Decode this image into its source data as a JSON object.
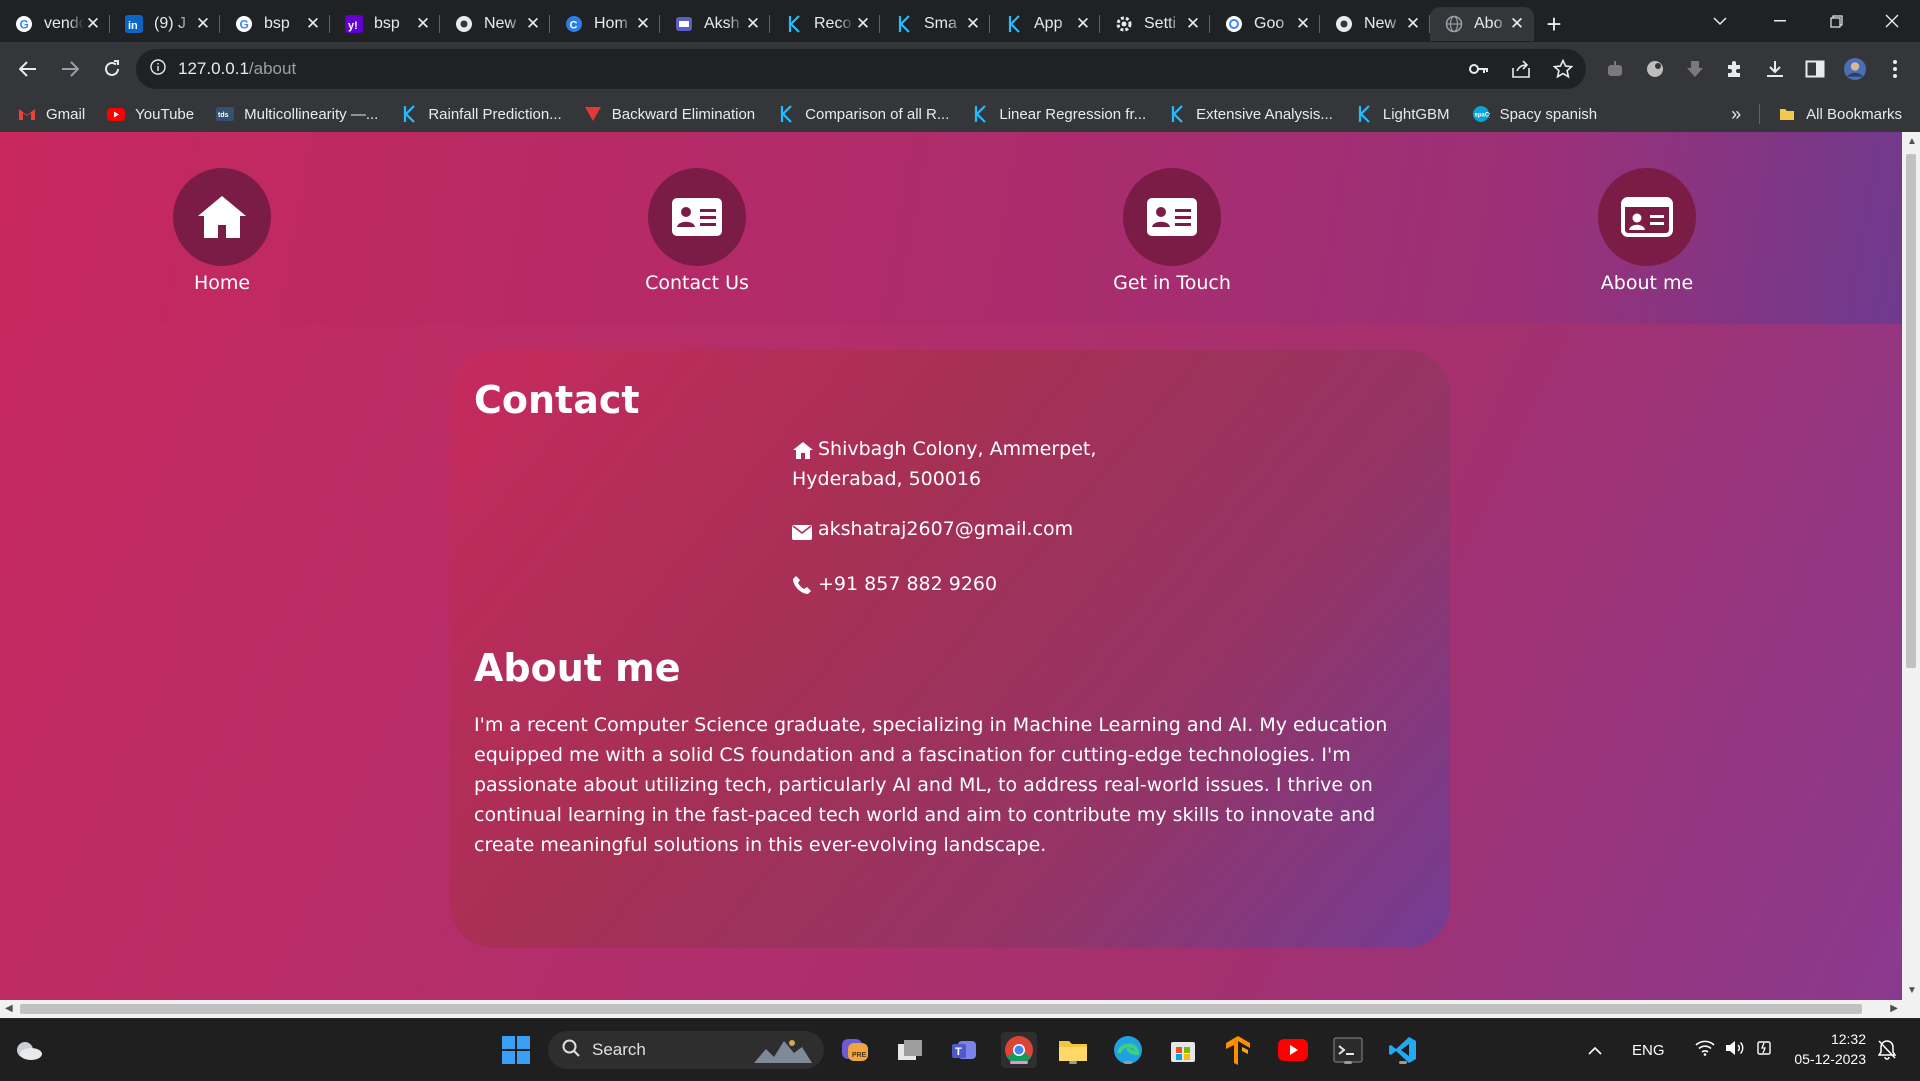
{
  "browser": {
    "tabs": [
      {
        "title": "vendor",
        "icon": "google-icon",
        "color": "#ffffff"
      },
      {
        "title": "(9) J",
        "icon": "linkedin-icon",
        "color": "#0a66c2"
      },
      {
        "title": "bsp",
        "icon": "google-icon",
        "color": "#ffffff"
      },
      {
        "title": "bsp",
        "icon": "yahoo-icon",
        "color": "#6001d2"
      },
      {
        "title": "New",
        "icon": "chrome-icon",
        "color": "#ffffff"
      },
      {
        "title": "Hom",
        "icon": "c-logo-icon",
        "color": "#2b7de9"
      },
      {
        "title": "Aksh",
        "icon": "app-icon",
        "color": "#5b5fc7"
      },
      {
        "title": "Reco",
        "icon": "kaggle-icon",
        "color": "#20beff"
      },
      {
        "title": "Sma",
        "icon": "kaggle-icon",
        "color": "#20beff"
      },
      {
        "title": "App",
        "icon": "kaggle-icon",
        "color": "#20beff"
      },
      {
        "title": "Setti",
        "icon": "gear-icon",
        "color": "#e8eaed"
      },
      {
        "title": "Goo",
        "icon": "google-lens-icon",
        "color": "#ffffff"
      },
      {
        "title": "New",
        "icon": "chrome-icon",
        "color": "#ffffff"
      },
      {
        "title": "Abo",
        "icon": "globe-icon",
        "color": "#9aa0a6",
        "active": true
      }
    ],
    "url_host": "127.0.0.1",
    "url_path": "/about",
    "bookmarks": [
      {
        "label": "Gmail",
        "icon": "gmail-icon"
      },
      {
        "label": "YouTube",
        "icon": "youtube-icon"
      },
      {
        "label": "Multicollinearity —...",
        "icon": "tds-icon"
      },
      {
        "label": "Rainfall Prediction...",
        "icon": "kaggle-icon"
      },
      {
        "label": "Backward Elimination",
        "icon": "triangle-icon"
      },
      {
        "label": "Comparison of all R...",
        "icon": "kaggle-icon"
      },
      {
        "label": "Linear Regression fr...",
        "icon": "kaggle-icon"
      },
      {
        "label": "Extensive Analysis...",
        "icon": "kaggle-icon"
      },
      {
        "label": "LightGBM",
        "icon": "kaggle-icon"
      },
      {
        "label": "Spacy spanish",
        "icon": "spacy-icon"
      }
    ],
    "bookmarks_overflow": "»",
    "all_bookmarks": "All Bookmarks"
  },
  "page": {
    "nav": [
      {
        "label": "Home",
        "icon": "home-icon"
      },
      {
        "label": "Contact Us",
        "icon": "address-card-icon"
      },
      {
        "label": "Get in Touch",
        "icon": "address-card-icon"
      },
      {
        "label": "About me",
        "icon": "id-card-icon"
      }
    ],
    "contact_title": "Contact",
    "address_line1": "Shivbagh Colony, Ammerpet,",
    "address_line2": "Hyderabad, 500016",
    "email": "akshatraj2607@gmail.com",
    "phone": "+91 857 882 9260",
    "about_title": "About me",
    "about_text": "I'm a recent Computer Science graduate, specializing in Machine Learning and AI. My education equipped me with a solid CS foundation and a fascination for cutting-edge technologies. I'm passionate about utilizing tech, particularly AI and ML, to address real-world issues. I thrive on continual learning in the fast-paced tech world and aim to contribute my skills to innovate and create meaningful solutions in this ever-evolving landscape."
  },
  "taskbar": {
    "search_label": "Search",
    "lang": "ENG",
    "time": "12:32",
    "date": "05-12-2023"
  }
}
